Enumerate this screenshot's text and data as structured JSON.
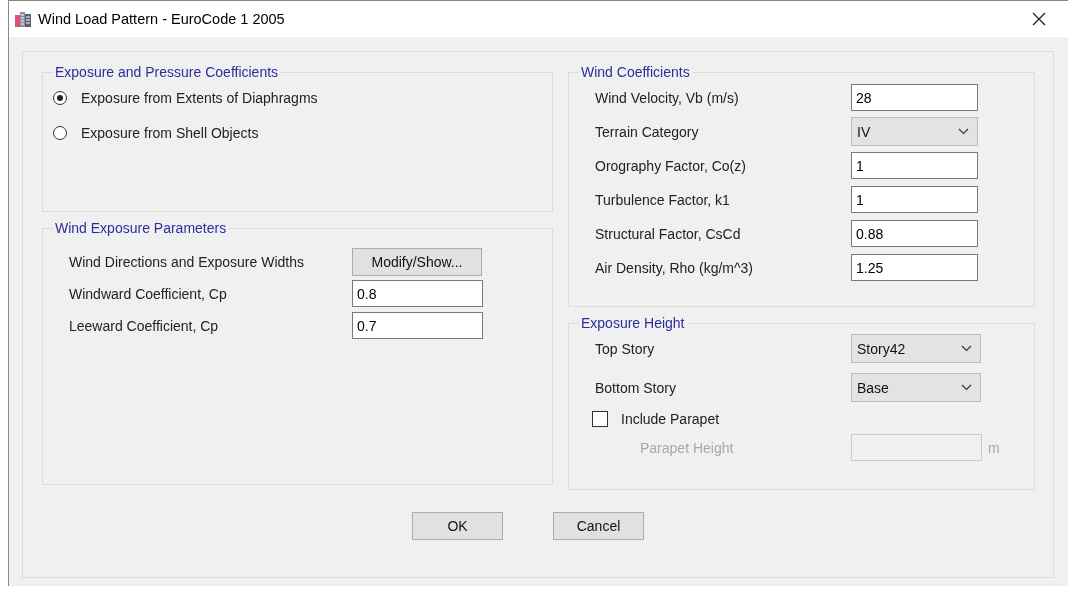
{
  "window": {
    "title": "Wind Load Pattern - EuroCode 1 2005"
  },
  "exposure_and_pressure": {
    "title": "Exposure and Pressure Coefficients",
    "options": [
      {
        "label": "Exposure from Extents of Diaphragms",
        "selected": true
      },
      {
        "label": "Exposure from Shell Objects",
        "selected": false
      }
    ]
  },
  "wind_exposure_parameters": {
    "title": "Wind Exposure Parameters",
    "rows": [
      {
        "kind": "button",
        "label": "Wind Directions and Exposure Widths",
        "button": "Modify/Show..."
      },
      {
        "kind": "input",
        "label": "Windward Coefficient, Cp",
        "value": "0.8"
      },
      {
        "kind": "input",
        "label": "Leeward Coefficient, Cp",
        "value": "0.7"
      }
    ]
  },
  "wind_coefficients": {
    "title": "Wind Coefficients",
    "rows": [
      {
        "kind": "input",
        "label": "Wind Velocity, Vb (m/s)",
        "value": "28"
      },
      {
        "kind": "dropdown",
        "label": "Terrain Category",
        "value": "IV"
      },
      {
        "kind": "input",
        "label": "Orography Factor, Co(z)",
        "value": "1"
      },
      {
        "kind": "input",
        "label": "Turbulence Factor, k1",
        "value": "1"
      },
      {
        "kind": "input",
        "label": "Structural Factor, CsCd",
        "value": "0.88"
      },
      {
        "kind": "input",
        "label": "Air Density, Rho (kg/m^3)",
        "value": "1.25"
      }
    ]
  },
  "exposure_height": {
    "title": "Exposure Height",
    "rows": [
      {
        "kind": "dropdown",
        "label": "Top Story",
        "value": "Story42"
      },
      {
        "kind": "dropdown",
        "label": "Bottom Story",
        "value": "Base"
      }
    ],
    "include_parapet": {
      "label": "Include Parapet",
      "checked": false
    },
    "parapet_height": {
      "label": "Parapet Height",
      "unit": "m",
      "disabled": true
    }
  },
  "buttons": [
    "OK",
    "Cancel"
  ]
}
